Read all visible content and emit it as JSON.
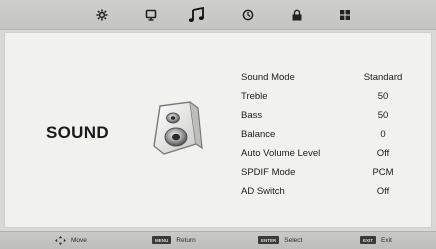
{
  "tabs": [
    {
      "name": "picture",
      "icon": "gear-icon",
      "active": false
    },
    {
      "name": "screen",
      "icon": "tv-icon",
      "active": false
    },
    {
      "name": "sound",
      "icon": "music-note-icon",
      "active": true
    },
    {
      "name": "time",
      "icon": "clock-icon",
      "active": false
    },
    {
      "name": "lock",
      "icon": "lock-icon",
      "active": false
    },
    {
      "name": "setup",
      "icon": "grid-icon",
      "active": false
    }
  ],
  "section": {
    "title": "SOUND",
    "icon": "speaker-icon"
  },
  "menu": [
    {
      "label": "Sound Mode",
      "value": "Standard"
    },
    {
      "label": "Treble",
      "value": "50"
    },
    {
      "label": "Bass",
      "value": "50"
    },
    {
      "label": "Balance",
      "value": "0"
    },
    {
      "label": "Auto Volume Level",
      "value": "Off"
    },
    {
      "label": "SPDIF Mode",
      "value": "PCM"
    },
    {
      "label": "AD Switch",
      "value": "Off"
    }
  ],
  "help": {
    "move": {
      "label": "Move",
      "icon": "arrows-icon"
    },
    "return": {
      "key": "MENU",
      "label": "Return"
    },
    "select": {
      "key": "ENTER",
      "label": "Select"
    },
    "exit": {
      "key": "EXIT",
      "label": "Exit"
    }
  }
}
